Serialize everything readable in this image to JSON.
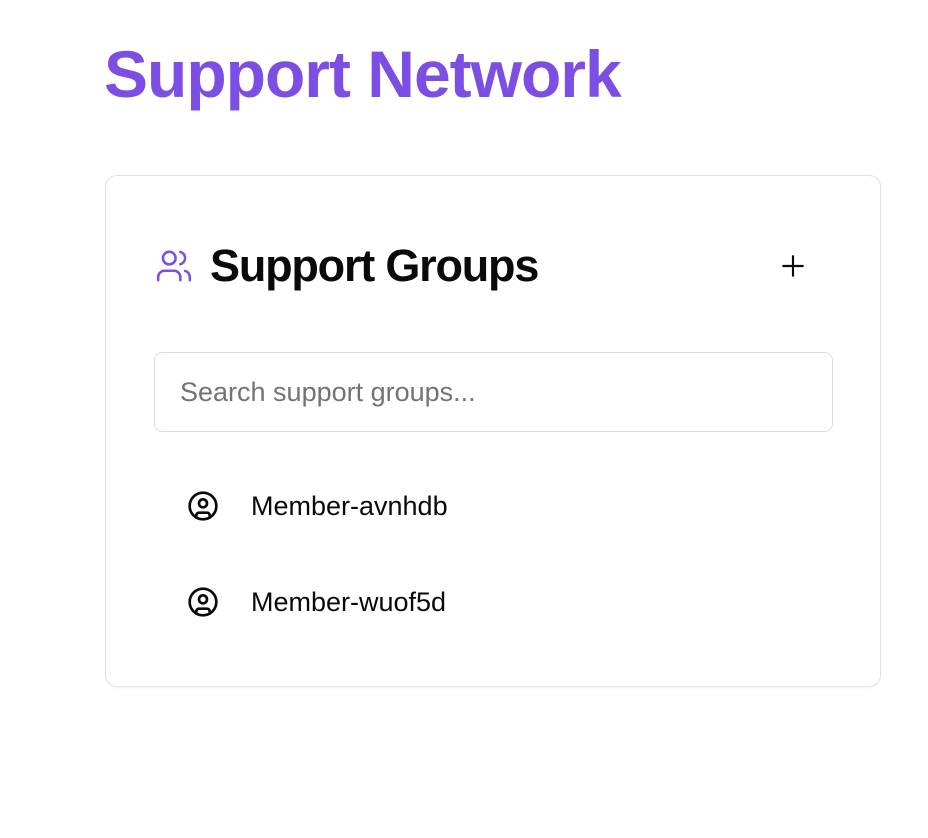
{
  "colors": {
    "accent": "#7c4ee4",
    "text": "#0a0a0a",
    "placeholder": "#737373",
    "border": "#e2e2e2"
  },
  "page": {
    "title": "Support Network"
  },
  "support_groups": {
    "title": "Support Groups",
    "title_icon": "users-icon",
    "add_button_icon": "plus-icon",
    "search": {
      "placeholder": "Search support groups...",
      "value": ""
    },
    "members": [
      {
        "name": "Member-avnhdb",
        "icon": "user-circle-icon"
      },
      {
        "name": "Member-wuof5d",
        "icon": "user-circle-icon"
      }
    ]
  }
}
